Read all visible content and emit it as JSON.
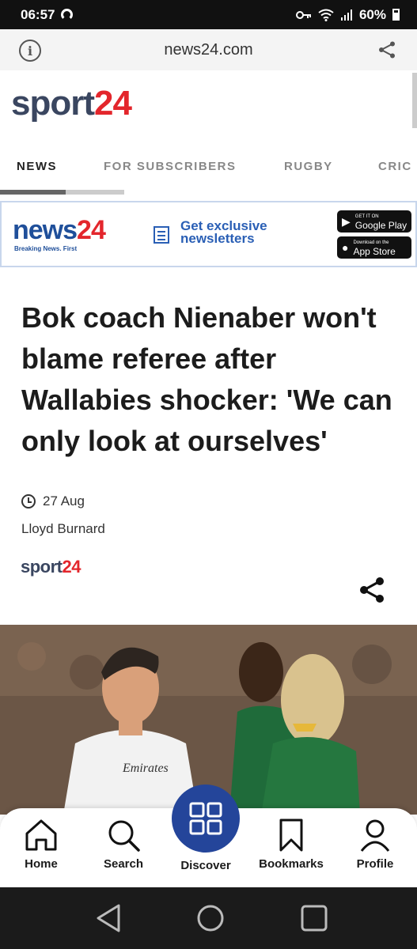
{
  "status_bar": {
    "time": "06:57",
    "battery": "60%"
  },
  "url_bar": {
    "url": "news24.com",
    "info_glyph": "i"
  },
  "site_logo": {
    "part1": "sport",
    "part2": "24"
  },
  "tabs": [
    {
      "label": "NEWS",
      "active": true
    },
    {
      "label": "FOR SUBSCRIBERS",
      "active": false
    },
    {
      "label": "RUGBY",
      "active": false
    },
    {
      "label": "CRIC",
      "active": false
    }
  ],
  "ad": {
    "brand_part1": "news",
    "brand_part2": "24",
    "tagline": "Breaking News. First",
    "cta_line1": "Get exclusive",
    "cta_line2": "newsletters",
    "google_small": "GET IT ON",
    "google_big": "Google Play",
    "apple_small": "Download on the",
    "apple_big": "App Store"
  },
  "article": {
    "headline": "Bok coach Nienaber won't blame referee after Wallabies shocker: 'We can only look at ourselves'",
    "date": "27 Aug",
    "author": "Lloyd Burnard",
    "source_logo_part1": "sport",
    "source_logo_part2": "24"
  },
  "bottom_nav": {
    "home": "Home",
    "search": "Search",
    "discover": "Discover",
    "bookmarks": "Bookmarks",
    "profile": "Profile"
  },
  "colors": {
    "brand_navy": "#3a4660",
    "brand_red": "#e3262c",
    "discover_blue": "#24459a"
  }
}
